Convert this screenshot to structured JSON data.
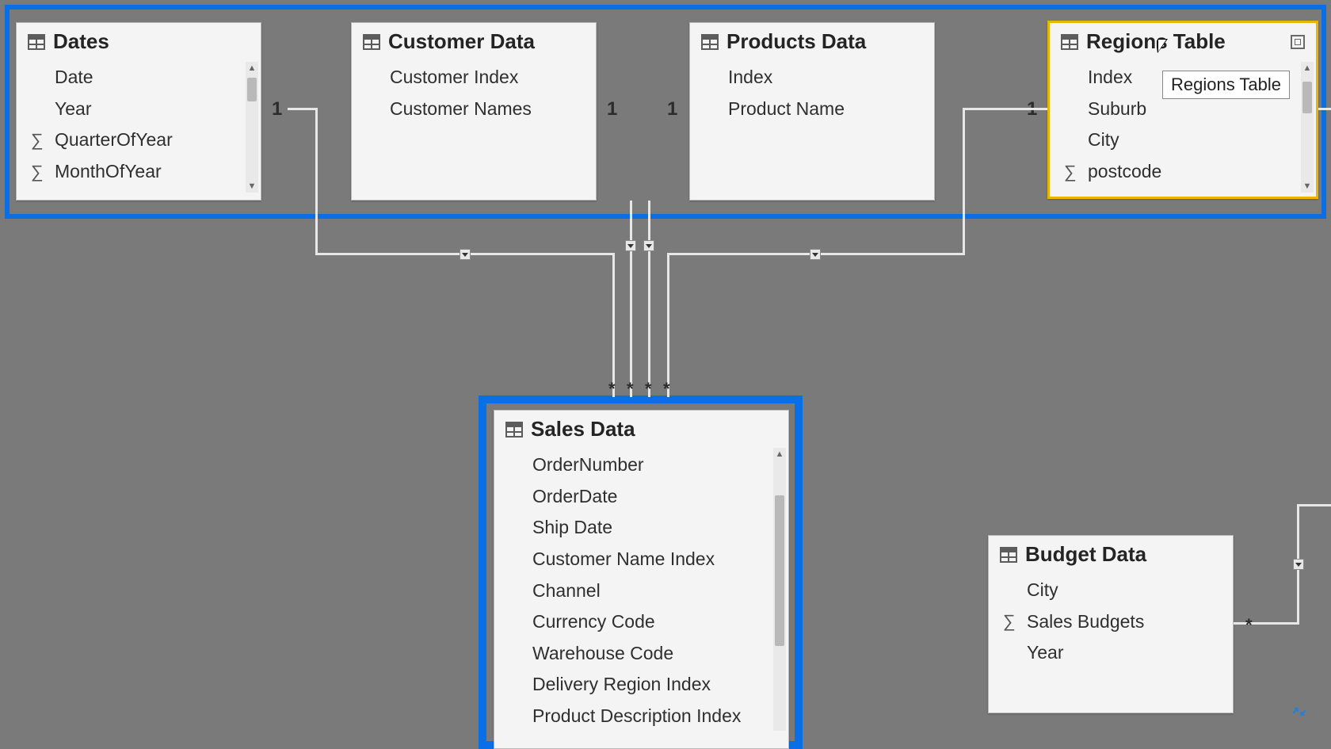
{
  "tables": {
    "dates": {
      "title": "Dates",
      "fields": [
        "Date",
        "Year",
        "QuarterOfYear",
        "MonthOfYear"
      ],
      "sigma_idx": [
        2,
        3
      ]
    },
    "customer": {
      "title": "Customer Data",
      "fields": [
        "Customer Index",
        "Customer Names"
      ]
    },
    "products": {
      "title": "Products Data",
      "fields": [
        "Index",
        "Product Name"
      ]
    },
    "regions": {
      "title": "Regions Table",
      "fields": [
        "Index",
        "Suburb",
        "City",
        "postcode"
      ],
      "sigma_idx": [
        3
      ],
      "tooltip": "Regions Table"
    },
    "sales": {
      "title": "Sales Data",
      "fields": [
        "OrderNumber",
        "OrderDate",
        "Ship Date",
        "Customer Name Index",
        "Channel",
        "Currency Code",
        "Warehouse Code",
        "Delivery Region Index",
        "Product Description Index"
      ]
    },
    "budget": {
      "title": "Budget Data",
      "fields": [
        "City",
        "Sales Budgets",
        "Year"
      ],
      "sigma_idx": [
        1
      ]
    }
  },
  "cardinality": {
    "one": "1",
    "many": "*"
  }
}
